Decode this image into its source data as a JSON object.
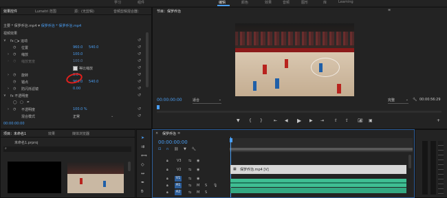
{
  "top_nav": {
    "items": [
      "学习",
      "组件",
      "编辑",
      "颜色",
      "效果",
      "音频",
      "图形",
      "库",
      "Learning"
    ],
    "active": 2
  },
  "effect_controls": {
    "tabs": [
      "效果控件",
      "Lumetri 范围",
      "源：(无剪辑)",
      "音频剪辑混合器："
    ],
    "breadcrumb_master": "主要 * 保罗乔治.mp4",
    "breadcrumb_clip": "保罗乔治 * 保罗乔治.mp4",
    "section_video": "视频效果",
    "fx_motion": "fx □▸ 运动",
    "position": {
      "label": "位置",
      "x": "960.0",
      "y": "540.0"
    },
    "scale": {
      "label": "缩放",
      "value": "100.0"
    },
    "scale_width": {
      "label": "缩放宽度",
      "value": "100.0"
    },
    "uniform_scale": "等比缩放",
    "rotation": {
      "label": "旋转",
      "value": "0.0"
    },
    "anchor": {
      "label": "锚点",
      "x": "960.0",
      "y": "540.0"
    },
    "antiflicker": {
      "label": "防闪烁滤镜",
      "value": "0.00"
    },
    "fx_opacity": "fx 不透明度",
    "opacity": {
      "label": "不透明度",
      "value": "100.0 %"
    },
    "blend_mode": {
      "label": "混合模式",
      "value": "正常"
    },
    "timecode": "00:00:00:00"
  },
  "program_monitor": {
    "title": "节目：保罗乔治",
    "timecode": "00:00:00:00",
    "fit": "适合",
    "quality": "完整",
    "duration": "00:00:56:29"
  },
  "project_panel": {
    "tabs": [
      "项目：未命名1",
      "效果",
      "媒体浏览器"
    ],
    "file": "未命名1.prproj"
  },
  "timeline": {
    "tab": "保罗乔治",
    "timecode": "00:00:00:00",
    "tracks": [
      "V3",
      "V2",
      "V1",
      "A1",
      "A2"
    ],
    "clip_label": "保罗乔治.mp4 [V]"
  },
  "colors": {
    "accent": "#4a9ff5",
    "panel": "#232323",
    "bg": "#1d1d1d",
    "audio_clip": "#3fbf93",
    "video_clip": "#d8d8d8",
    "red_annotation": "#e0201d"
  }
}
